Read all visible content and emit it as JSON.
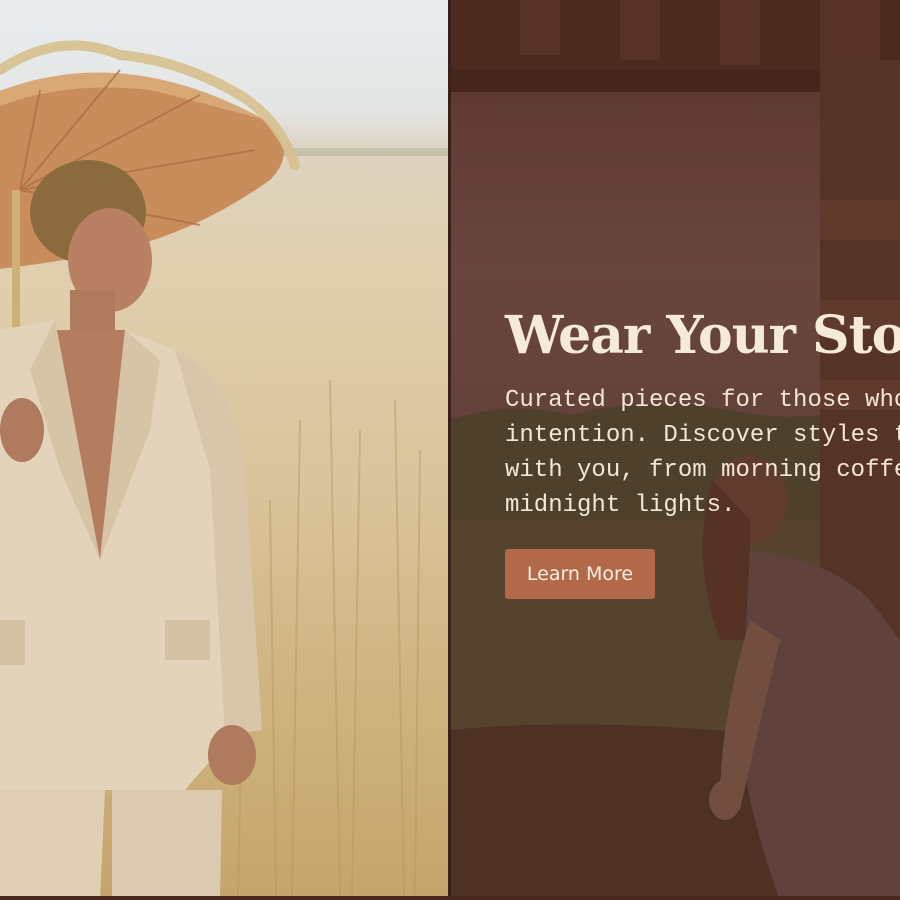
{
  "hero": {
    "title": "Wear Your Story",
    "body_lines": [
      "Curated pieces for those who live with",
      "intention. Discover styles that move",
      "with you, from morning coffee to",
      "midnight lights."
    ],
    "cta_label": "Learn More"
  },
  "colors": {
    "cta_background": "#b2694a",
    "overlay": "#522820",
    "title_text": "#f6ead9"
  }
}
